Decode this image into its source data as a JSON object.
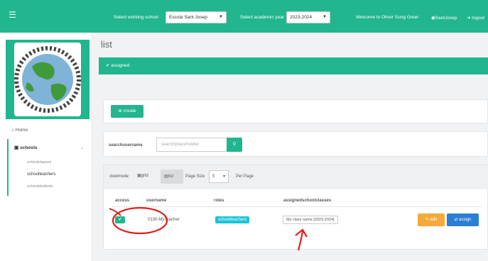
{
  "topbar": {
    "menu_icon": "hamburger-icon",
    "school_label": "Select working school",
    "school_value": "Escola Sant Josep",
    "year_label": "Select academic year",
    "year_value": "2023-2024",
    "welcome": "Welcome to Oliver Sung Greer",
    "user": "SantJosep",
    "logout": "logout"
  },
  "sidebar": {
    "home": "Home",
    "schools": "schools",
    "subitems": [
      "schoolclasses",
      "schoolteachers",
      "schoolstudents"
    ]
  },
  "main": {
    "title": "list",
    "alert": "assigned",
    "create": "create",
    "search_label": "searchusername",
    "search_placeholder": "searchplaceholder",
    "viewmode_label": "viewmode",
    "grid": "grid",
    "list": "list",
    "page_size_label": "Page Size",
    "page_size_value": "5",
    "per_page": "Per Page",
    "columns": [
      "access",
      "username",
      "roles",
      "assignedschoolclasses"
    ],
    "row": {
      "username": "0130-MyTeacher",
      "role": "schoolteachers",
      "class": "My class name [2023-2024]",
      "edit": "edit",
      "assign": "assign"
    }
  },
  "colors": {
    "accent": "#21b68e",
    "edit": "#f6a93b",
    "assign": "#2a7fd4",
    "badge": "#1bc4d6",
    "annotation": "#e0201b"
  }
}
